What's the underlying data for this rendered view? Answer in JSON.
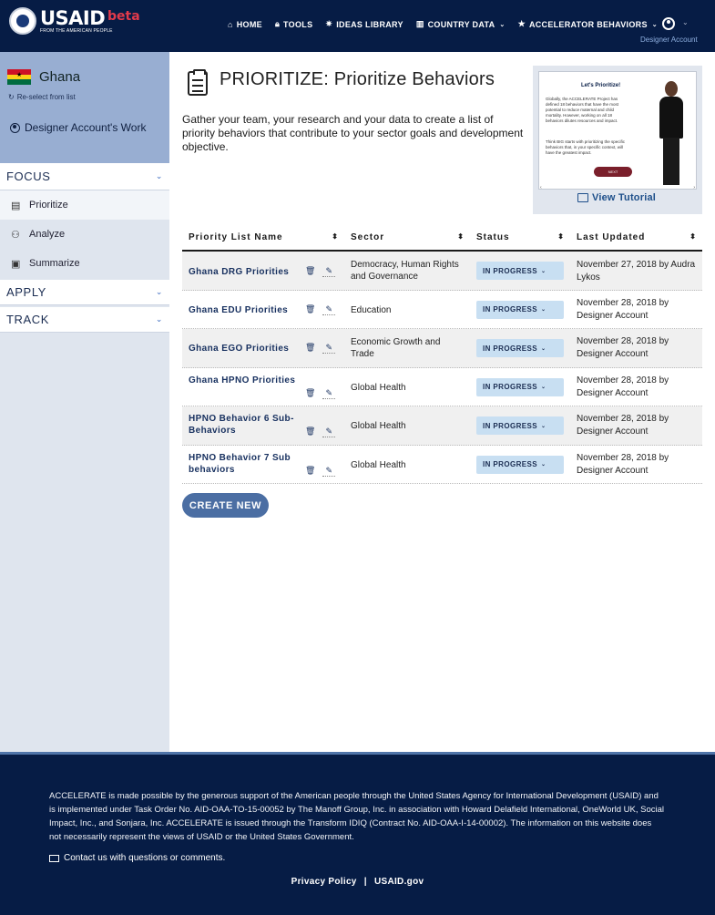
{
  "brand": {
    "name": "USAID",
    "tagline": "FROM THE AMERICAN PEOPLE",
    "badge": "beta",
    "accent": "#061c45",
    "badge_color": "#e23a4b"
  },
  "nav": {
    "items": [
      {
        "label": "HOME",
        "icon": "home-icon"
      },
      {
        "label": "TOOLS",
        "icon": "lock-icon"
      },
      {
        "label": "IDEAS LIBRARY",
        "icon": "lightbulb-icon"
      },
      {
        "label": "COUNTRY DATA",
        "icon": "bar-chart-icon",
        "dropdown": true
      },
      {
        "label": "ACCELERATOR BEHAVIORS",
        "icon": "star-icon",
        "dropdown": true
      }
    ],
    "account_label": "Designer Account"
  },
  "sidebar": {
    "country": "Ghana",
    "reselect_label": "Re-select from list",
    "work_label": "Designer Account's Work",
    "sections": {
      "focus": "FOCUS",
      "apply": "APPLY",
      "track": "TRACK"
    },
    "focus_items": [
      {
        "label": "Prioritize",
        "icon": "clipboard-list-icon",
        "active": true
      },
      {
        "label": "Analyze",
        "icon": "people-network-icon"
      },
      {
        "label": "Summarize",
        "icon": "summary-icon"
      }
    ]
  },
  "main": {
    "title": "PRIORITIZE: Prioritize Behaviors",
    "description": "Gather your team, your research and your data to create a list of priority behaviors that contribute to your sector goals and development objective.",
    "tutorial": {
      "heading": "Let's Prioritize!",
      "body": "Globally, the ACCELERATE Project has defined 18 behaviors that have the most potential to reduce maternal and child mortality. However, working on all 18 behaviors dilutes resources and impact.",
      "body2": "Think BIG starts with prioritizing the specific behaviors that, in your specific context, will have the greatest impact.",
      "next_label": "NEXT",
      "link_label": "View Tutorial"
    },
    "table": {
      "columns": [
        "Priority List Name",
        "Sector",
        "Status",
        "Last Updated"
      ],
      "rows": [
        {
          "name": "Ghana DRG Priorities",
          "sector": "Democracy, Human Rights and Governance",
          "status": "IN PROGRESS",
          "updated": "November 27, 2018 by Audra Lykos"
        },
        {
          "name": "Ghana EDU Priorities",
          "sector": "Education",
          "status": "IN PROGRESS",
          "updated": "November 28, 2018 by Designer Account"
        },
        {
          "name": "Ghana EGO Priorities",
          "sector": "Economic Growth and Trade",
          "status": "IN PROGRESS",
          "updated": "November 28, 2018 by Designer Account"
        },
        {
          "name": "Ghana HPNO Priorities",
          "sector": "Global Health",
          "status": "IN PROGRESS",
          "updated": "November 28, 2018 by Designer Account"
        },
        {
          "name": "HPNO Behavior 6 Sub-Behaviors",
          "sector": "Global Health",
          "status": "IN PROGRESS",
          "updated": "November 28, 2018 by Designer Account"
        },
        {
          "name": "HPNO Behavior 7 Sub behaviors",
          "sector": "Global Health",
          "status": "IN PROGRESS",
          "updated": "November 28, 2018 by Designer Account"
        }
      ]
    },
    "create_label": "CREATE NEW"
  },
  "footer": {
    "text": "ACCELERATE is made possible by the generous support of the American people through the United States Agency for International Development (USAID) and is implemented under Task Order No. AID-OAA-TO-15-00052 by The Manoff Group, Inc. in association with Howard Delafield International, OneWorld UK, Social Impact, Inc., and Sonjara, Inc. ACCELERATE is issued through the Transform IDIQ (Contract No. AID-OAA-I-14-00002). The information on this website does not necessarily represent the views of USAID or the United States Government.",
    "contact": "Contact us with questions or comments.",
    "privacy": "Privacy Policy",
    "separator": "|",
    "usaid_link": "USAID.gov"
  }
}
